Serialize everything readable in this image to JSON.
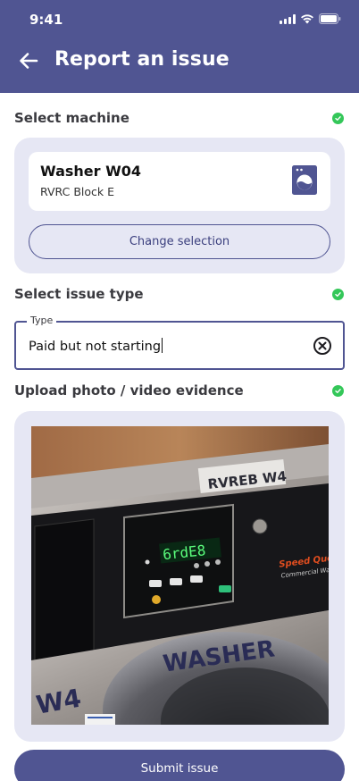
{
  "status_bar": {
    "time": "9:41"
  },
  "header": {
    "title": "Report an issue",
    "back_icon": "arrow-left-icon"
  },
  "sections": {
    "machine": {
      "label": "Select machine",
      "complete": true
    },
    "issue": {
      "label": "Select issue type",
      "complete": true
    },
    "evidence": {
      "label": "Upload photo / video evidence",
      "complete": true
    }
  },
  "machine": {
    "name": "Washer W04",
    "location": "RVRC Block E",
    "icon": "washing-machine-icon",
    "change_label": "Change selection"
  },
  "issue_type": {
    "legend": "Type",
    "value": "Paid but not starting",
    "clear_icon": "clear-circle-icon"
  },
  "evidence_photo": {
    "tag_text": "RVREB W4",
    "display_text": "6rdE8",
    "brand_text": "Speed Queen",
    "brand_sub": "Commercial Washer",
    "door_text": "WASHER",
    "unit_text": "W4"
  },
  "submit": {
    "label": "Submit issue"
  },
  "colors": {
    "primary": "#505592",
    "panel": "#e6e7f4",
    "success": "#34c759"
  }
}
